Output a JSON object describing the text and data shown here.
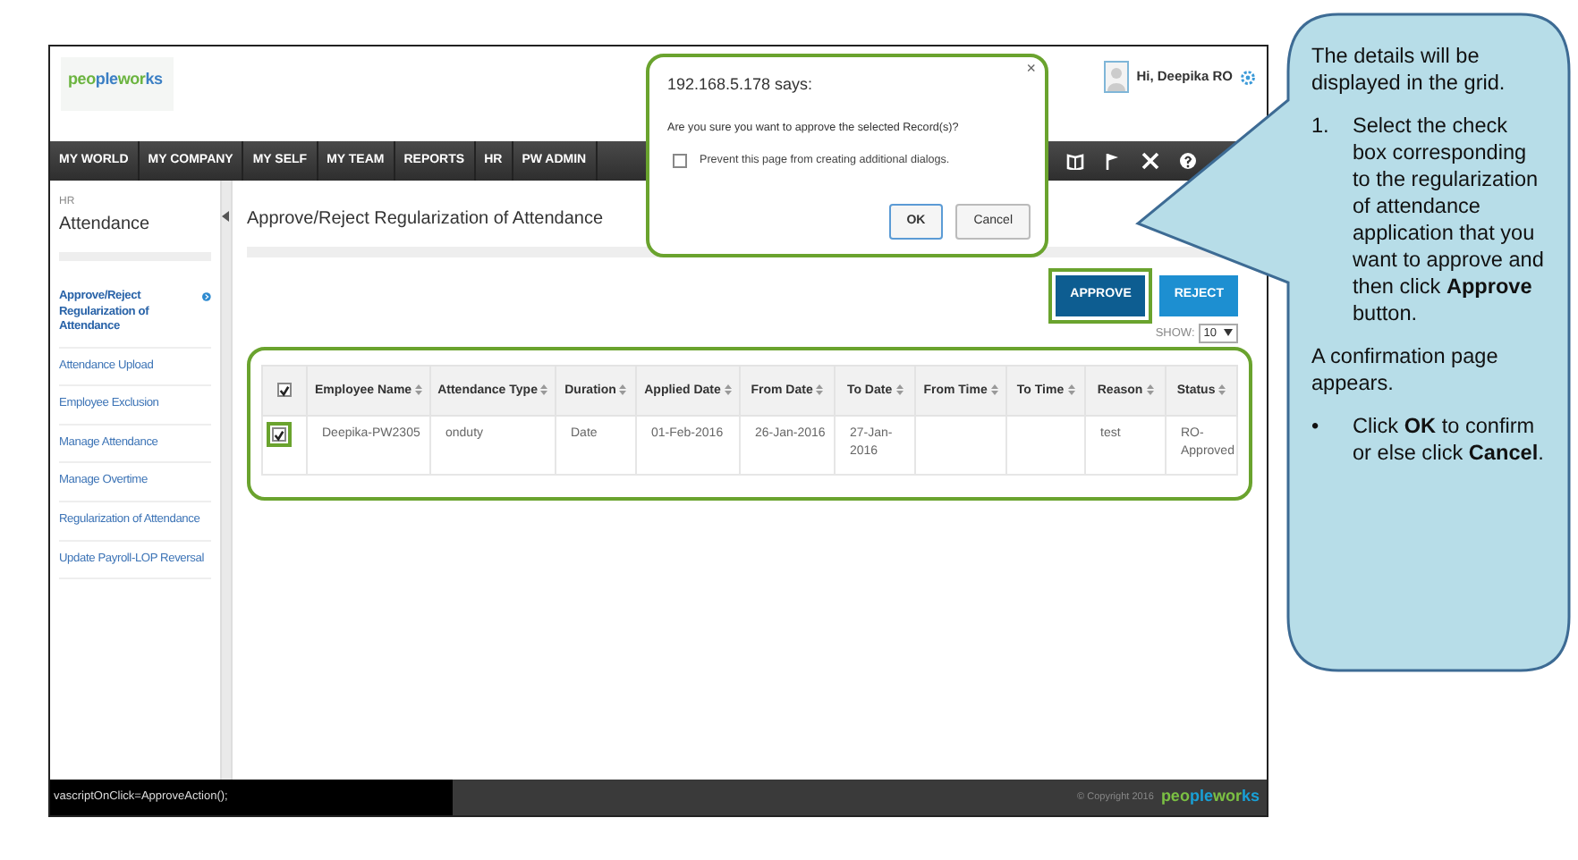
{
  "app": {
    "logo": "peopleworks",
    "user_greeting": "Hi, Deepika RO"
  },
  "nav": [
    {
      "label": "MY WORLD"
    },
    {
      "label": "MY COMPANY"
    },
    {
      "label": "MY SELF"
    },
    {
      "label": "MY TEAM"
    },
    {
      "label": "REPORTS"
    },
    {
      "label": "HR"
    },
    {
      "label": "PW ADMIN"
    }
  ],
  "sidebar": {
    "section": "HR",
    "title": "Attendance",
    "items": [
      {
        "label": "Approve/Reject Regularization of Attendance",
        "selected": true
      },
      {
        "label": "Attendance Upload",
        "selected": false
      },
      {
        "label": "Employee Exclusion",
        "selected": false
      },
      {
        "label": "Manage Attendance",
        "selected": false
      },
      {
        "label": "Manage Overtime",
        "selected": false
      },
      {
        "label": "Regularization of Attendance",
        "selected": false
      },
      {
        "label": "Update Payroll-LOP Reversal",
        "selected": false
      }
    ]
  },
  "page_title": "Approve/Reject Regularization of Attendance",
  "actions": [
    {
      "label": "APPROVE",
      "highlighted": true
    },
    {
      "label": "REJECT",
      "highlighted": false
    }
  ],
  "show": {
    "label": "SHOW:",
    "value": "10"
  },
  "table": {
    "highlighted": true,
    "header_checked": true,
    "columns": [
      "Employee Name",
      "Attendance Type",
      "Duration",
      "Applied Date",
      "From Date",
      "To Date",
      "From Time",
      "To Time",
      "Reason",
      "Status"
    ],
    "rows": [
      {
        "checked": true,
        "highlighted": true,
        "cells": [
          "Deepika-PW2305",
          "onduty",
          "Date",
          "01-Feb-2016",
          "26-Jan-2016",
          "27-Jan-2016",
          null,
          null,
          "test",
          "RO-Approved"
        ]
      }
    ]
  },
  "status_bar": "vascriptOnClick=ApproveAction();",
  "footer": {
    "copyright": "© Copyright 2016",
    "logo": "peopleworks"
  },
  "dialog": {
    "highlighted": true,
    "title": "192.168.5.178 says:",
    "close": "×",
    "message": "Are you sure you want to approve the selected Record(s)?",
    "checkbox": {
      "label": "Prevent this page from creating additional dialogs.",
      "checked": false
    },
    "buttons": [
      {
        "label": "OK",
        "focused": true
      },
      {
        "label": "Cancel",
        "focused": false
      }
    ]
  },
  "callout": {
    "blocks": [
      {
        "kind": "para",
        "text": "The details will be displayed in the grid."
      },
      {
        "kind": "item",
        "marker": "1.",
        "text": "Select the check box corresponding to the regularization of attendance application that you want to approve and then click **Approve** button."
      },
      {
        "kind": "para",
        "text": "A confirmation page appears."
      },
      {
        "kind": "item",
        "marker": "•",
        "text": "Click **OK** to confirm or else click **Cancel**."
      }
    ]
  }
}
